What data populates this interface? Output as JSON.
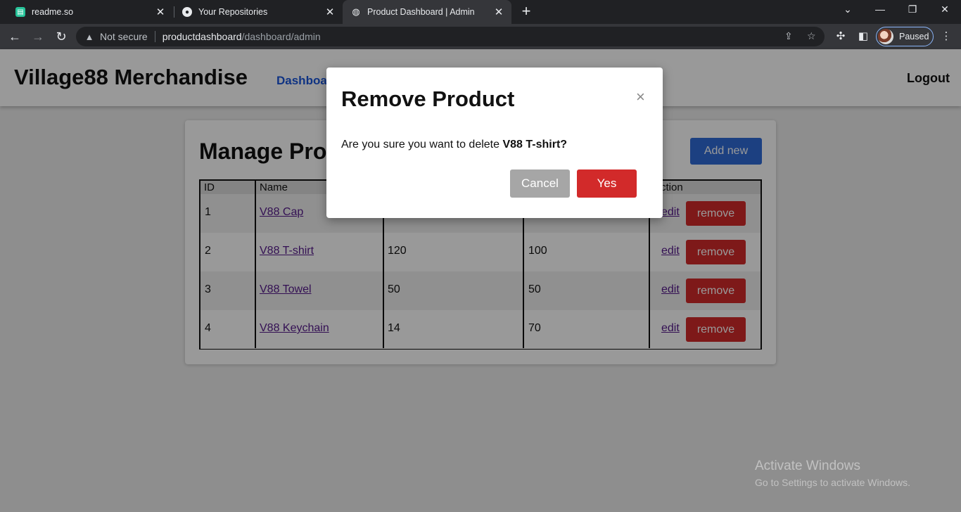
{
  "browser": {
    "tabs": [
      {
        "title": "readme.so",
        "icon": "readme-favicon-icon"
      },
      {
        "title": "Your Repositories",
        "icon": "github-icon"
      },
      {
        "title": "Product Dashboard | Admin",
        "icon": "globe-icon"
      }
    ],
    "security_label": "Not secure",
    "url_host": "productdashboard",
    "url_path": "/dashboard/admin",
    "profile_status": "Paused"
  },
  "header": {
    "brand": "Village88 Merchandise",
    "nav_dashboard": "Dashboa",
    "logout": "Logout"
  },
  "main": {
    "title": "Manage Pro",
    "add_new": "Add new",
    "columns": {
      "id": "ID",
      "name": "Name",
      "action": "ction"
    },
    "rows": [
      {
        "id": "1",
        "name": "V88 Cap",
        "col3": "",
        "col4": "",
        "edit": "edit",
        "remove": "remove"
      },
      {
        "id": "2",
        "name": "V88 T-shirt",
        "col3": "120",
        "col4": "100",
        "edit": "edit",
        "remove": "remove"
      },
      {
        "id": "3",
        "name": "V88 Towel",
        "col3": "50",
        "col4": "50",
        "edit": "edit",
        "remove": "remove"
      },
      {
        "id": "4",
        "name": "V88 Keychain",
        "col3": "14",
        "col4": "70",
        "edit": "edit",
        "remove": "remove"
      }
    ]
  },
  "modal": {
    "title": "Remove Product",
    "close": "×",
    "message_prefix": "Are you sure you want to delete ",
    "product_name": "V88 T-shirt?",
    "cancel": "Cancel",
    "confirm": "Yes"
  },
  "watermark": {
    "title": "Activate Windows",
    "subtitle": "Go to Settings to activate Windows."
  },
  "colors": {
    "primary": "#2f6bd8",
    "danger": "#d32b2b",
    "cancel": "#a6a6a6"
  }
}
